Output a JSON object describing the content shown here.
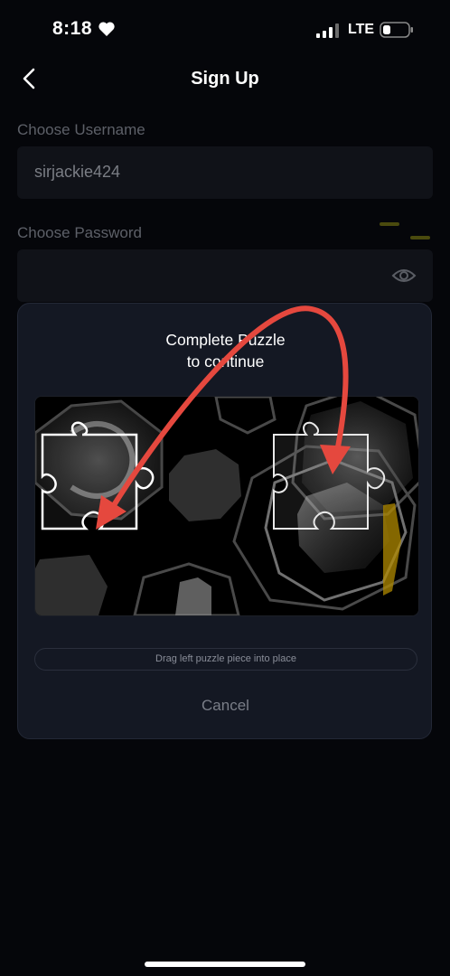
{
  "status_bar": {
    "time": "8:18",
    "network": "LTE"
  },
  "nav": {
    "title": "Sign Up"
  },
  "form": {
    "username_label": "Choose Username",
    "username_value": "sirjackie424",
    "password_label": "Choose Password",
    "password_value": ""
  },
  "modal": {
    "title_line1": "Complete Puzzle",
    "title_line2": "to continue",
    "slider_label": "Drag left puzzle piece into place",
    "cancel_label": "Cancel"
  },
  "colors": {
    "background": "#05060a",
    "modal_bg": "#141823",
    "annotation_arrow": "#e5483e"
  },
  "icons": [
    "heart-icon",
    "signal-icon",
    "battery-icon",
    "chevron-left-icon",
    "eye-icon",
    "puzzle-piece-icon"
  ]
}
